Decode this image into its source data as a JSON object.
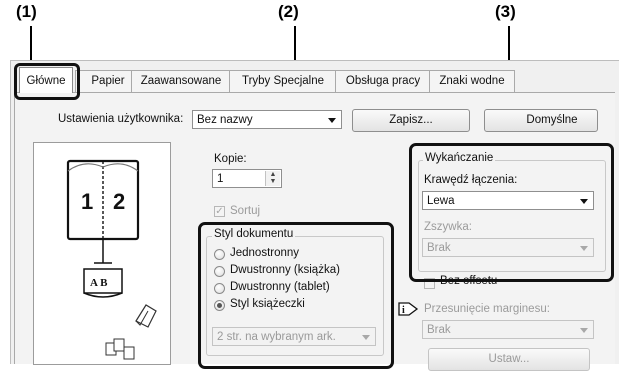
{
  "callouts": [
    "(1)",
    "(2)",
    "(3)"
  ],
  "tabs": [
    {
      "label": "Główne"
    },
    {
      "label": "Papier"
    },
    {
      "label": "Zaawansowane"
    },
    {
      "label": "Tryby Specjalne"
    },
    {
      "label": "Obsługa pracy"
    },
    {
      "label": "Znaki wodne"
    }
  ],
  "user_settings": {
    "label": "Ustawienia użytkownika:",
    "value": "Bez nazwy",
    "save_button": "Zapisz...",
    "default_button": "Domyślne"
  },
  "preview": {
    "page_left": "1",
    "page_right": "2",
    "book_glyph": "A B"
  },
  "copies": {
    "label": "Kopie:",
    "value": "1",
    "collate_label": "Sortuj",
    "collate_checked": true
  },
  "document_style": {
    "title": "Styl dokumentu",
    "options": [
      "Jednostronny",
      "Dwustronny (książka)",
      "Dwustronny (tablet)",
      "Styl książeczki"
    ],
    "selected": "Styl książeczki",
    "pages_per_sheet": "2 str. na wybranym ark."
  },
  "finishing": {
    "title": "Wykańczanie",
    "binding_edge_label": "Krawędź łączenia:",
    "binding_edge_value": "Lewa",
    "staple_label": "Zszywka:",
    "staple_value": "Brak"
  },
  "offset": {
    "label": "Bez offsetu"
  },
  "margin_shift": {
    "label": "Przesunięcie marginesu:",
    "value": "Brak",
    "settings_button": "Ustaw..."
  }
}
